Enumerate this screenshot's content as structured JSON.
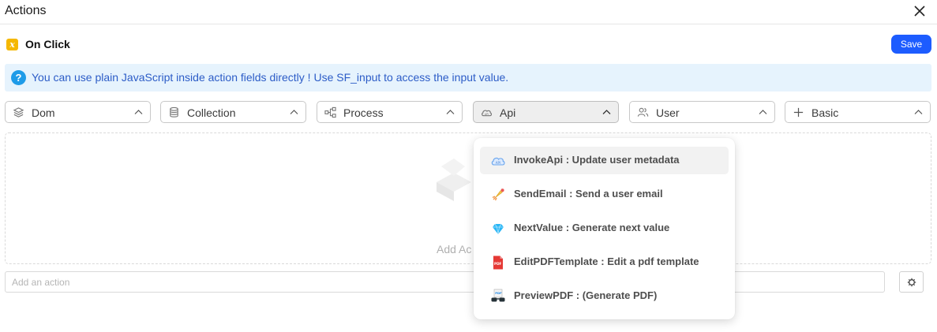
{
  "window": {
    "title": "Actions"
  },
  "event": {
    "label": "On Click"
  },
  "toolbar": {
    "save_label": "Save"
  },
  "info": {
    "text": "You can use plain JavaScript inside action fields directly ! Use SF_input to access the input value."
  },
  "categories": [
    {
      "label": "Dom",
      "icon": "layers-icon"
    },
    {
      "label": "Collection",
      "icon": "database-icon"
    },
    {
      "label": "Process",
      "icon": "workflow-icon"
    },
    {
      "label": "Api",
      "icon": "cloud-api-icon",
      "active": true
    },
    {
      "label": "User",
      "icon": "users-icon"
    },
    {
      "label": "Basic",
      "icon": "plus-icon"
    }
  ],
  "empty": {
    "text": "Add Ac"
  },
  "add_action": {
    "placeholder": "Add an action"
  },
  "dropdown": {
    "items": [
      {
        "label": "InvokeApi : Update user metadata",
        "icon": "cloud-api-icon",
        "highlighted": true
      },
      {
        "label": "SendEmail : Send a user email",
        "icon": "rocket-icon"
      },
      {
        "label": "NextValue : Generate next value",
        "icon": "diamond-icon"
      },
      {
        "label": "EditPDFTemplate : Edit a pdf template",
        "icon": "pdf-file-icon"
      },
      {
        "label": "PreviewPDF : (Generate PDF)",
        "icon": "pdf-glasses-icon"
      }
    ]
  },
  "colors": {
    "accent": "#1d5cff",
    "info_bg": "#e6f3fd",
    "info_text": "#2c5cc7",
    "event_icon": "#f5b800"
  }
}
